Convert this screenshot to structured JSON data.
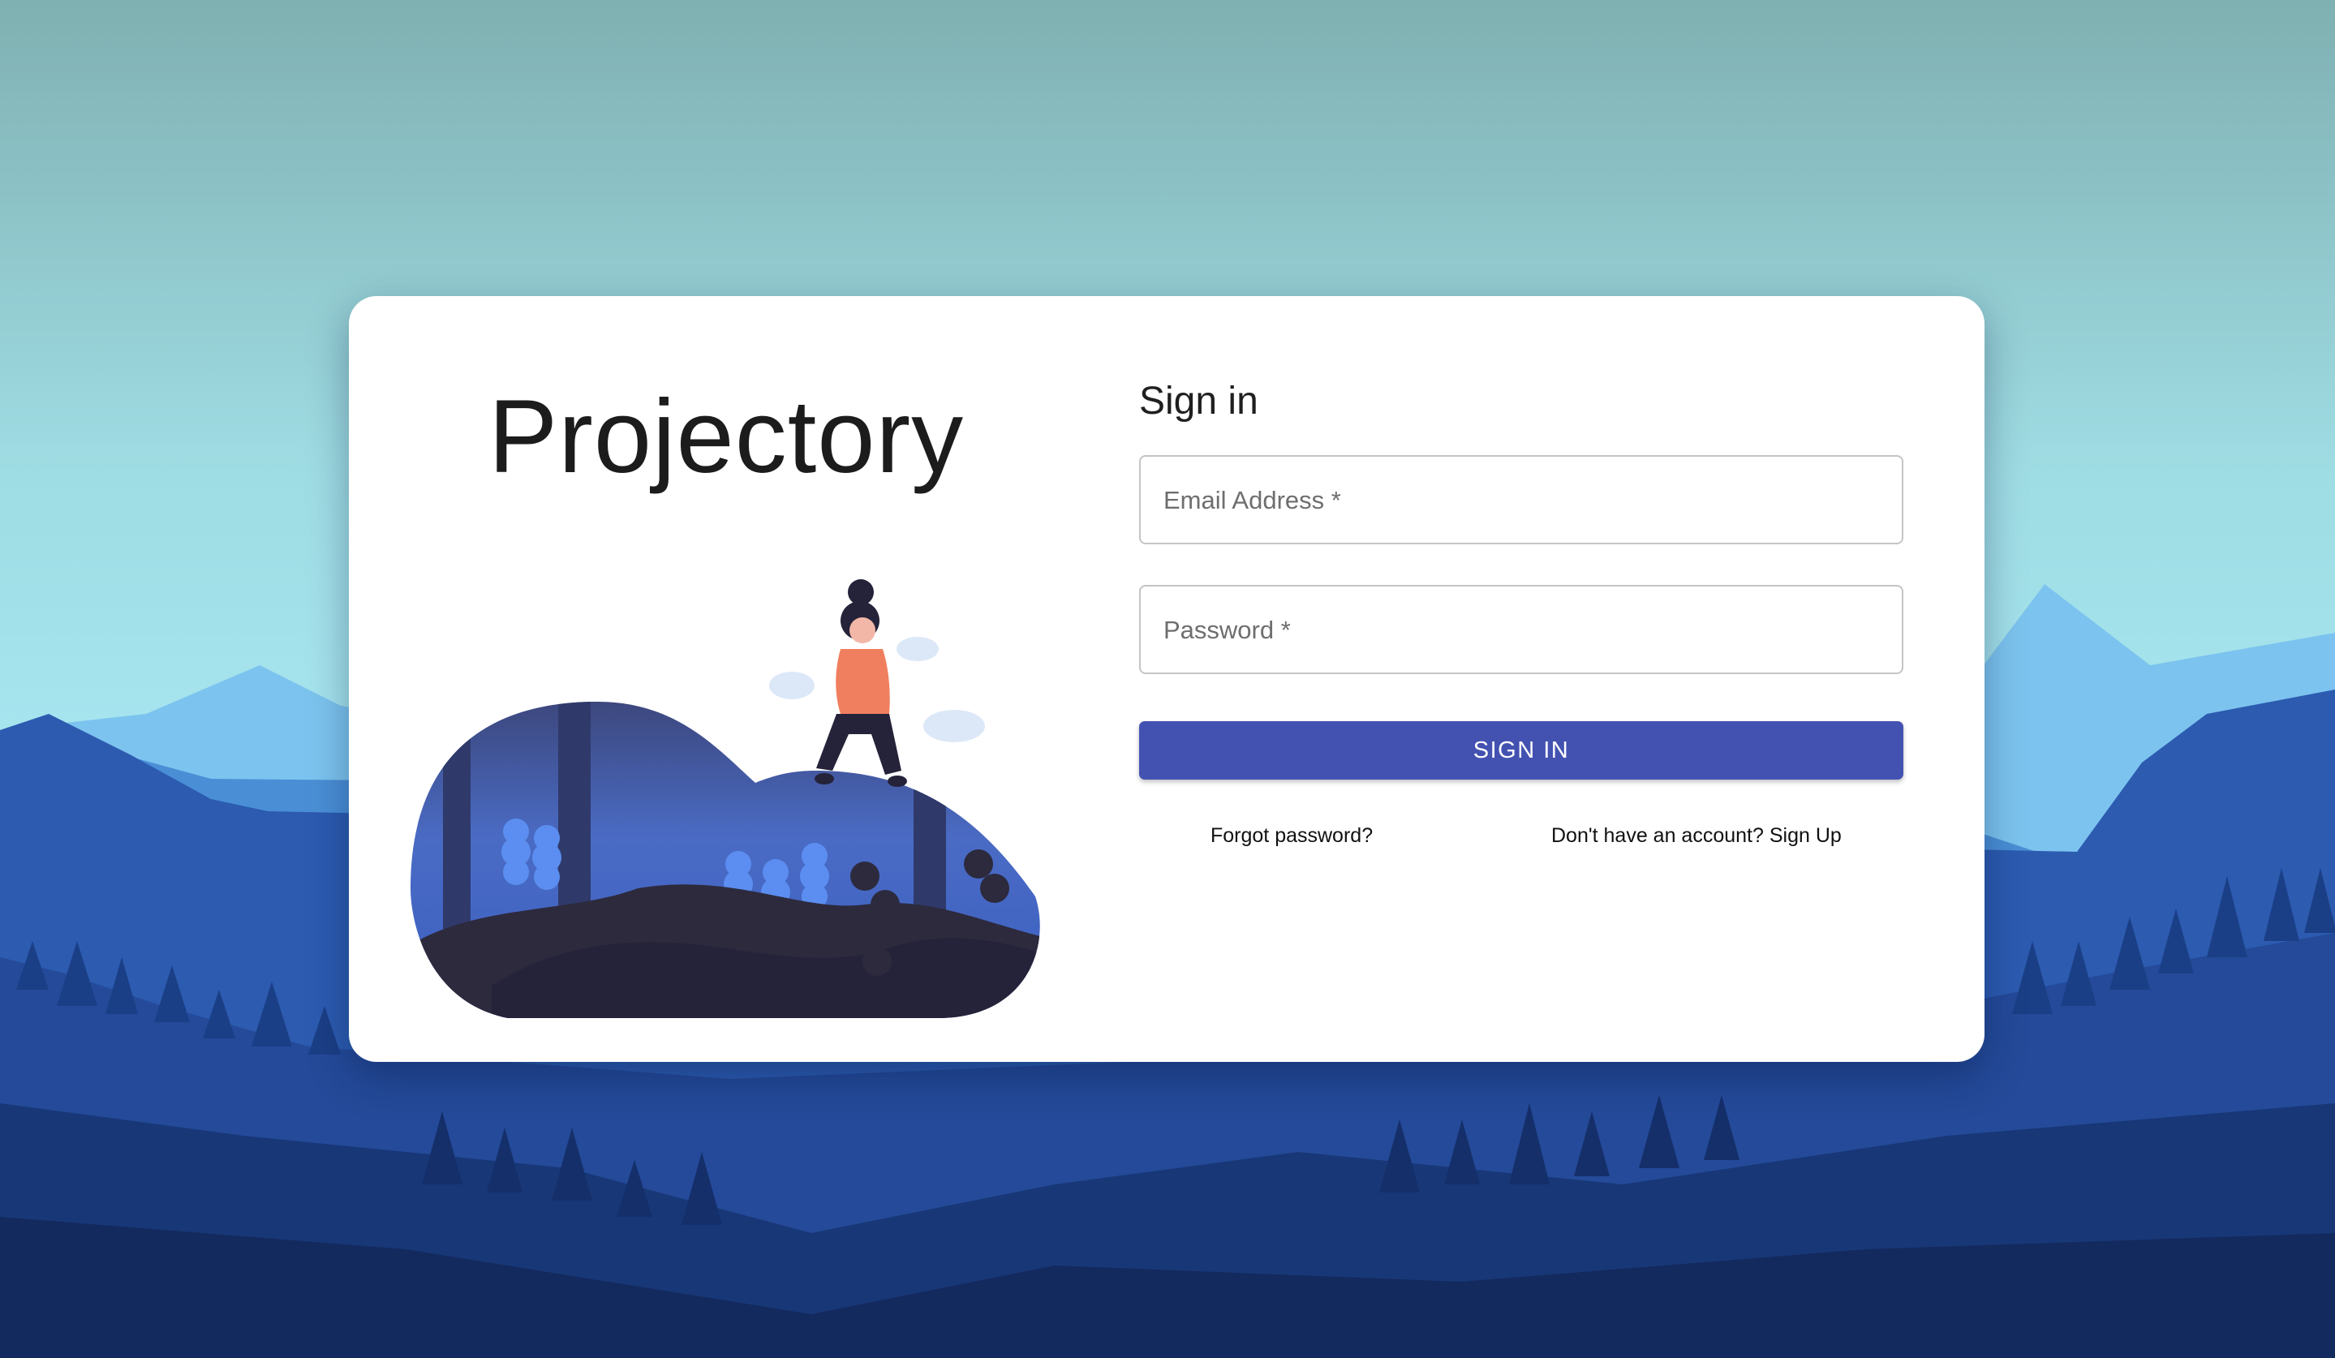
{
  "app": {
    "brand": "Projectory"
  },
  "signin": {
    "title": "Sign in",
    "email_label": "Email Address *",
    "password_label": "Password *",
    "submit_label": "SIGN IN",
    "forgot_link": "Forgot password?",
    "signup_link": "Don't have an account? Sign Up"
  },
  "colors": {
    "primary": "#4352b1",
    "card": "#ffffff",
    "sky_top": "#7fb3b4",
    "sky_mid": "#a6e3ec",
    "forest_dark": "#132a5e"
  },
  "icons": {
    "illustration": "woman-sitting-on-forest-blob-illustration"
  }
}
